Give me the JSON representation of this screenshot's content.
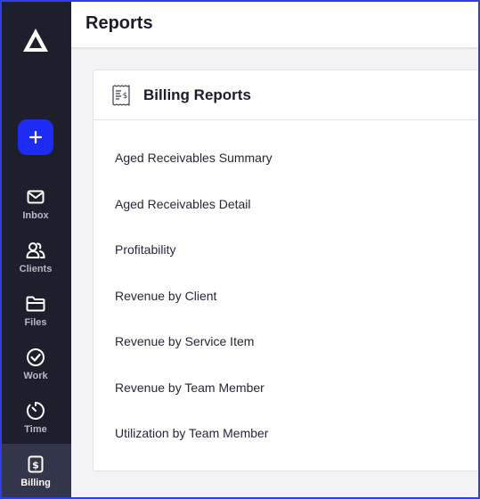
{
  "sidebar": {
    "add_label": "+",
    "items": [
      {
        "label": "Inbox",
        "icon": "mail-icon"
      },
      {
        "label": "Clients",
        "icon": "users-icon"
      },
      {
        "label": "Files",
        "icon": "folder-icon"
      },
      {
        "label": "Work",
        "icon": "check-circle-icon"
      },
      {
        "label": "Time",
        "icon": "timer-icon"
      },
      {
        "label": "Billing",
        "icon": "dollar-doc-icon",
        "active": true
      }
    ]
  },
  "header": {
    "title": "Reports"
  },
  "billing": {
    "title": "Billing Reports",
    "reports": [
      "Aged Receivables Summary",
      "Aged Receivables Detail",
      "Profitability",
      "Revenue by Client",
      "Revenue by Service Item",
      "Revenue by Team Member",
      "Utilization by Team Member"
    ]
  },
  "colors": {
    "sidebar_bg": "#1e1f2d",
    "accent": "#1d2cf5",
    "active_item_bg": "#33354a",
    "content_bg": "#f3f3f6"
  }
}
